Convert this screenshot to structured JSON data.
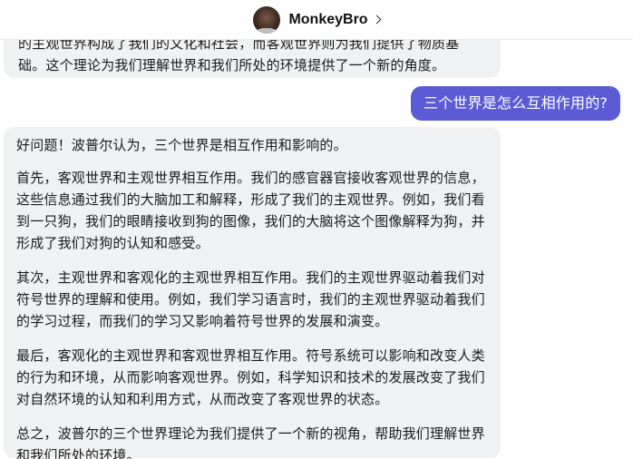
{
  "header": {
    "contact_name": "MonkeyBro"
  },
  "messages": {
    "previous_incoming": [
      "的主观世界构成了我们的文化和社会，而客观世界则为我们提供了物质基",
      "础。这个理论为我们理解世界和我们所处的环境提供了一个新的角度。"
    ],
    "outgoing": "三个世界是怎么互相作用的?",
    "reply": {
      "p1": "好问题！波普尔认为，三个世界是相互作用和影响的。",
      "p2": "首先，客观世界和主观世界相互作用。我们的感官器官接收客观世界的信息，这些信息通过我们的大脑加工和解释，形成了我们的主观世界。例如，我们看到一只狗，我们的眼睛接收到狗的图像，我们的大脑将这个图像解释为狗，并形成了我们对狗的认知和感受。",
      "p3": "其次，主观世界和客观化的主观世界相互作用。我们的主观世界驱动着我们对符号世界的理解和使用。例如，我们学习语言时，我们的主观世界驱动着我们的学习过程，而我们的学习又影响着符号世界的发展和演变。",
      "p4": "最后，客观化的主观世界和客观世界相互作用。符号系统可以影响和改变人类的行为和环境，从而影响客观世界。例如，科学知识和技术的发展改变了我们对自然环境的认知和利用方式，从而改变了客观世界的状态。",
      "p5": "总之，波普尔的三个世界理论为我们提供了一个新的视角，帮助我们理解世界和我们所处的环境。"
    }
  },
  "colors": {
    "outgoing_bubble": "#5b5bd6",
    "incoming_bubble": "#f0f1f2",
    "header_bg": "#ffffff"
  }
}
